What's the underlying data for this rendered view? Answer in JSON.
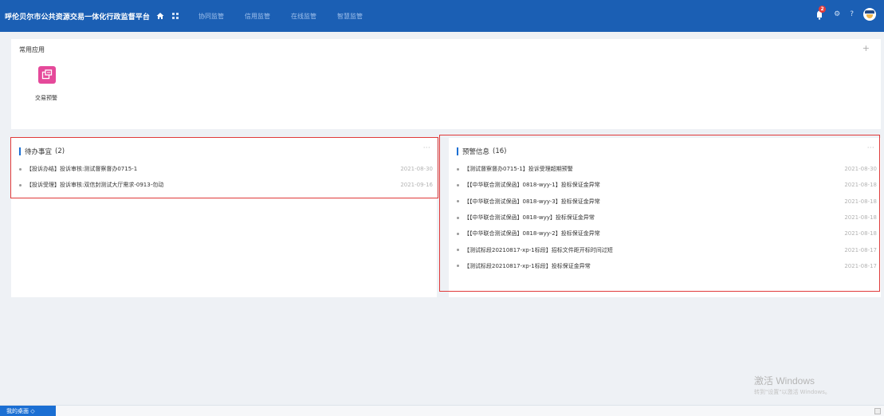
{
  "header": {
    "title": "呼伦贝尔市公共资源交易一体化行政监督平台",
    "nav": [
      "协同监管",
      "信用监管",
      "在线监管",
      "智慧监管"
    ],
    "notification_count": "2",
    "settings_glyph": "⚙",
    "help_glyph": "?",
    "colors": {
      "bar": "#1b5fb4",
      "nav_text": "#9fc0ec",
      "badge": "#e43b3b"
    }
  },
  "common_apps": {
    "title": "常用应用",
    "add_glyph": "+",
    "apps": [
      {
        "label": "交易预警",
        "icon": "transfer-icon",
        "color": "#e5499a"
      }
    ]
  },
  "todo": {
    "title": "待办事宜",
    "count": "(2)",
    "more": "···",
    "items": [
      {
        "text": "【投诉办结】投诉审核:测试督察督办0715-1",
        "date": "2021-08-30"
      },
      {
        "text": "【投诉受理】投诉审核:双信封测试大厅需求-0913-勿动",
        "date": "2021-09-16"
      }
    ]
  },
  "warnings": {
    "title": "预警信息",
    "count": "(16)",
    "more": "···",
    "items": [
      {
        "text": "【测试督察督办0715-1】投诉受理超期预警",
        "date": "2021-08-30"
      },
      {
        "text": "【【中华联合测试保函】0818-wyy-1】投标保证金异常",
        "date": "2021-08-18"
      },
      {
        "text": "【【中华联合测试保函】0818-wyy-3】投标保证金异常",
        "date": "2021-08-18"
      },
      {
        "text": "【【中华联合测试保函】0818-wyy】投标保证金异常",
        "date": "2021-08-18"
      },
      {
        "text": "【【中华联合测试保函】0818-wyy-2】投标保证金异常",
        "date": "2021-08-18"
      },
      {
        "text": "【测试标段20210817-xp-1标段】招标文件距开标时间过短",
        "date": "2021-08-17"
      },
      {
        "text": "【测试标段20210817-xp-1标段】投标保证金异常",
        "date": "2021-08-17"
      }
    ]
  },
  "watermark": {
    "line1": "激活 Windows",
    "line2": "转到\"设置\"以激活 Windows。"
  },
  "footer": {
    "tab_label": "我的桌面 ◇"
  }
}
